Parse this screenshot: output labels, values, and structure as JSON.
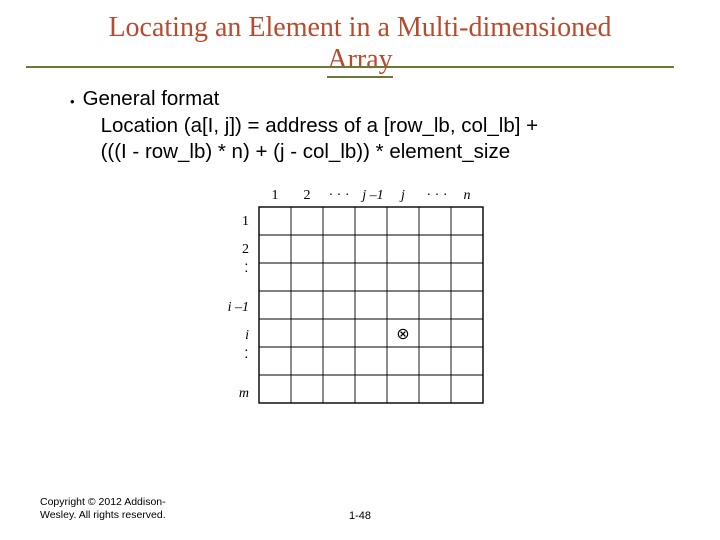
{
  "title_line1": "Locating an Element in a Multi-dimensioned",
  "title_line2": "Array",
  "bullet": "•",
  "body_line1": "General format",
  "body_line2": "Location (a[I, j]) = address of a [row_lb, col_lb] +",
  "body_line3": "(((I - row_lb) * n) + (j - col_lb)) * element_size",
  "figure": {
    "col_labels": [
      "1",
      "2",
      "j –1",
      "j",
      "n"
    ],
    "col_dots": "· · ·",
    "row_labels": [
      "1",
      "2",
      "i –1",
      "i",
      "m"
    ],
    "row_dots_a": ". .",
    "row_dots_b": ". .",
    "marker": "⊗"
  },
  "copyright_line1": "Copyright © 2012 Addison-",
  "copyright_line2": "Wesley. All rights reserved.",
  "pagenum": "1-48"
}
